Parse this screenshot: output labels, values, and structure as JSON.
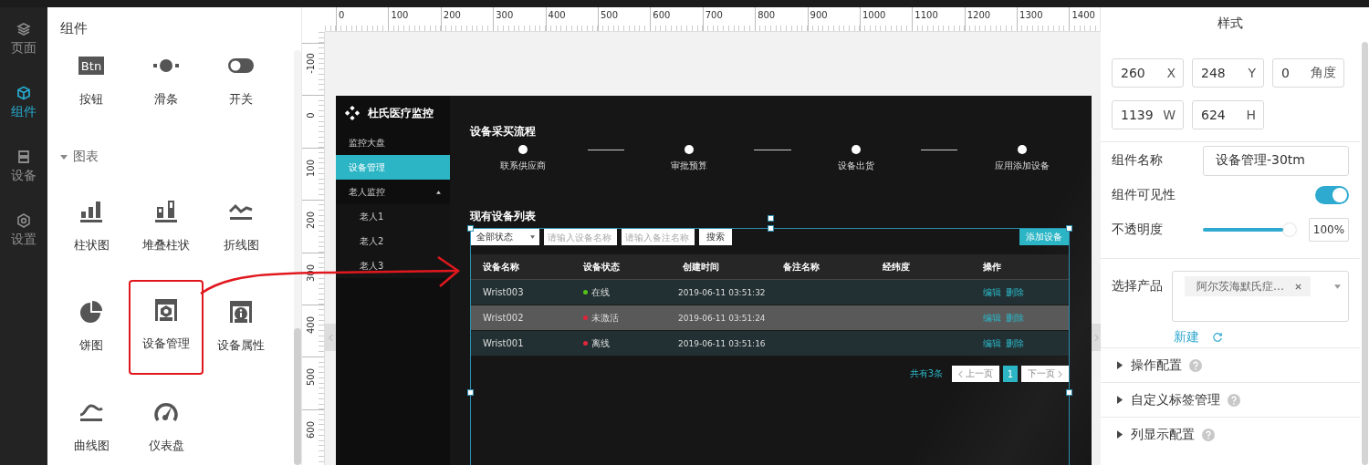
{
  "nav": [
    {
      "label": "页面",
      "selected": false
    },
    {
      "label": "组件",
      "selected": true
    },
    {
      "label": "设备",
      "selected": false
    },
    {
      "label": "设置",
      "selected": false
    }
  ],
  "components": {
    "title": "组件",
    "items": [
      {
        "label": "按钮",
        "icon_text": "Btn",
        "highlighted": false
      },
      {
        "label": "滑条",
        "highlighted": false
      },
      {
        "label": "开关",
        "highlighted": false
      }
    ],
    "chart_section": {
      "title": "图表",
      "expanded": true,
      "items": [
        {
          "label": "柱状图",
          "highlighted": false
        },
        {
          "label": "堆叠柱状",
          "highlighted": false
        },
        {
          "label": "折线图",
          "highlighted": false
        },
        {
          "label": "饼图",
          "highlighted": false
        },
        {
          "label": "设备管理",
          "highlighted": true
        },
        {
          "label": "设备属性",
          "highlighted": false
        },
        {
          "label": "曲线图",
          "highlighted": false
        },
        {
          "label": "仪表盘",
          "highlighted": false
        }
      ]
    }
  },
  "ruler": {
    "x_ticks": [
      "0",
      "100",
      "200",
      "300",
      "400",
      "500",
      "600",
      "700",
      "800",
      "900",
      "1000",
      "1100",
      "1200",
      "1300",
      "1400"
    ],
    "y_ticks": [
      "-100",
      "0",
      "100",
      "200",
      "300",
      "400",
      "500",
      "600"
    ]
  },
  "preview": {
    "brand": "杜氏医疗监控",
    "menu": [
      {
        "label": "监控大盘",
        "selected": false
      },
      {
        "label": "设备管理",
        "selected": true
      },
      {
        "label": "老人监控",
        "selected": false,
        "expanded": true,
        "children": [
          {
            "label": "老人1",
            "selected": false
          },
          {
            "label": "老人2",
            "selected": false
          },
          {
            "label": "老人3",
            "selected": false
          }
        ]
      }
    ],
    "process": {
      "title": "设备采买流程",
      "steps": [
        "联系供应商",
        "审批预算",
        "设备出货",
        "应用添加设备"
      ]
    },
    "list": {
      "title": "现有设备列表",
      "status_filter": "全部状态",
      "name_field": {
        "placeholder": "请输入设备名称"
      },
      "remark_field": {
        "placeholder": "请输入备注名称"
      },
      "search_button": "搜索",
      "add_button": "添加设备",
      "columns": [
        "设备名称",
        "设备状态",
        "创建时间",
        "备注名称",
        "经纬度",
        "操作"
      ],
      "rows": [
        {
          "name": "Wrist003",
          "status": "在线",
          "color": "#52c41a",
          "created": "2019-06-11 03:51:32",
          "actions": [
            "编辑",
            "删除"
          ],
          "highlighted": false
        },
        {
          "name": "Wrist002",
          "status": "未激活",
          "color": "#e0263a",
          "created": "2019-06-11 03:51:24",
          "actions": [
            "编辑",
            "删除"
          ],
          "highlighted": true
        },
        {
          "name": "Wrist001",
          "status": "离线",
          "color": "#e0263a",
          "created": "2019-06-11 03:51:16",
          "actions": [
            "编辑",
            "删除"
          ],
          "highlighted": false
        }
      ],
      "pagination": {
        "total": "共有3条",
        "prev": "上一页",
        "pages": [
          {
            "label": "1",
            "selected": true
          }
        ],
        "next": "下一页"
      }
    }
  },
  "properties": {
    "title": "样式",
    "geometry": [
      {
        "value": "260",
        "unit": "X"
      },
      {
        "value": "248",
        "unit": "Y"
      },
      {
        "value": "0",
        "unit": "角度"
      },
      {
        "value": "1139",
        "unit": "W"
      },
      {
        "value": "624",
        "unit": "H"
      }
    ],
    "name_label": "组件名称",
    "name_value": "设备管理-30tm",
    "visible_label": "组件可见性",
    "visible": true,
    "opacity_label": "不透明度",
    "opacity": {
      "level": 1,
      "reading": "100%"
    },
    "product_label": "选择产品",
    "product_tags": [
      "阿尔茨海默氏症…"
    ],
    "new_link": "新建",
    "sections": [
      {
        "label": "操作配置",
        "expanded": false,
        "help": true
      },
      {
        "label": "自定义标签管理",
        "expanded": false,
        "help": true
      },
      {
        "label": "列显示配置",
        "expanded": false,
        "help": true
      }
    ]
  }
}
